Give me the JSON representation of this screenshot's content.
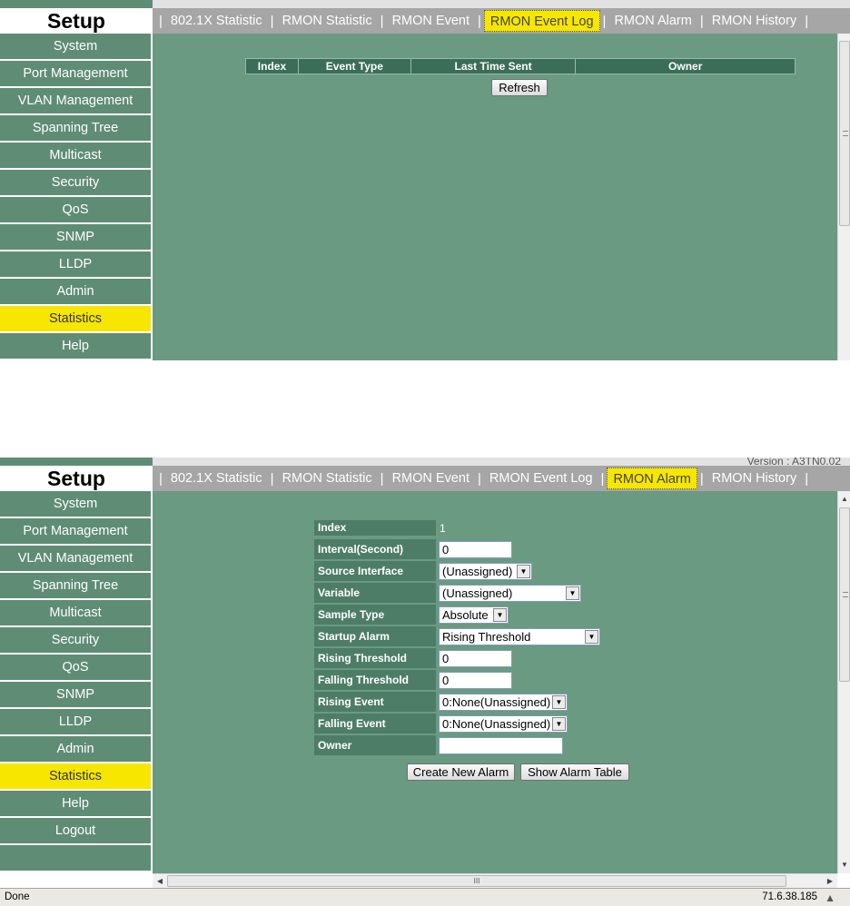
{
  "setup_title": "Setup",
  "version_text": "Version : A3TN0.02",
  "tabs": {
    "t1": "802.1X Statistic",
    "t2": "RMON Statistic",
    "t3": "RMON Event",
    "t4": "RMON Event Log",
    "t5": "RMON Alarm",
    "t6": "RMON History",
    "separator": "|"
  },
  "sidebar_top": [
    "System",
    "Port Management",
    "VLAN Management",
    "Spanning Tree",
    "Multicast",
    "Security",
    "QoS",
    "SNMP",
    "LLDP",
    "Admin",
    "Statistics",
    "Help"
  ],
  "sidebar_bottom": [
    "System",
    "Port Management",
    "VLAN Management",
    "Spanning Tree",
    "Multicast",
    "Security",
    "QoS",
    "SNMP",
    "LLDP",
    "Admin",
    "Statistics",
    "Help",
    "Logout"
  ],
  "active_sidebar": "Statistics",
  "event_log": {
    "columns": [
      "Index",
      "Event Type",
      "Last Time Sent",
      "Owner"
    ],
    "refresh_label": "Refresh"
  },
  "alarm_form": {
    "index_label": "Index",
    "index_value": "1",
    "interval_label": "Interval(Second)",
    "interval_value": "0",
    "source_interface_label": "Source Interface",
    "source_interface_value": "(Unassigned)",
    "variable_label": "Variable",
    "variable_value": "(Unassigned)",
    "sample_type_label": "Sample Type",
    "sample_type_value": "Absolute",
    "startup_alarm_label": "Startup Alarm",
    "startup_alarm_value": "Rising Threshold",
    "rising_threshold_label": "Rising Threshold",
    "rising_threshold_value": "0",
    "falling_threshold_label": "Falling Threshold",
    "falling_threshold_value": "0",
    "rising_event_label": "Rising Event",
    "rising_event_value": "0:None(Unassigned)",
    "falling_event_label": "Falling Event",
    "falling_event_value": "0:None(Unassigned)",
    "owner_label": "Owner",
    "owner_value": "",
    "create_button": "Create New Alarm",
    "show_button": "Show Alarm Table"
  },
  "scrollbar_grip": "III",
  "status": {
    "left": "Done",
    "ip": "71.6.38.185"
  },
  "colors": {
    "content_bg": "#6a9a82",
    "sidebar_bg": "#5f8c75",
    "active_yellow": "#f6e600",
    "tabbar_gray": "#a6a6a6"
  }
}
